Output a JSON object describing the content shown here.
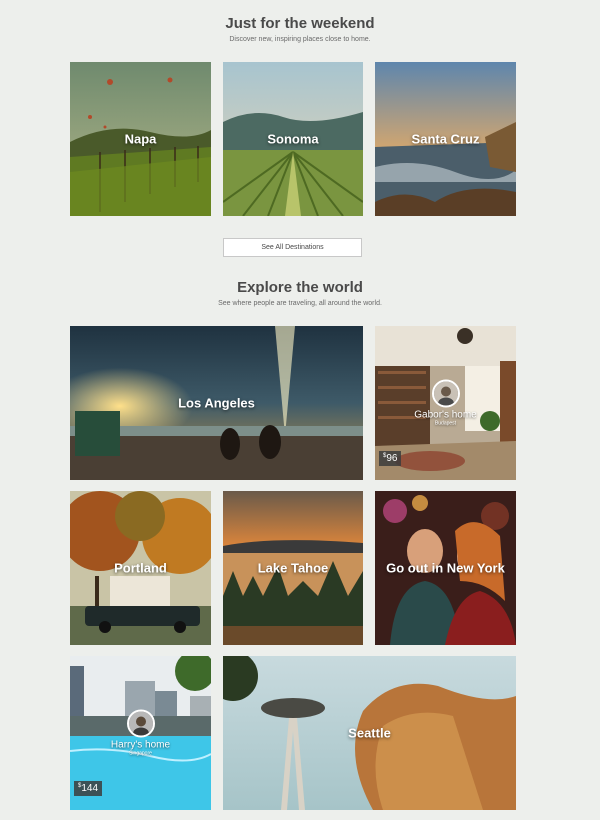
{
  "weekend": {
    "title": "Just for the weekend",
    "subtitle": "Discover new, inspiring places close to home.",
    "destinations": [
      "Napa",
      "Sonoma",
      "Santa Cruz"
    ],
    "button": "See All Destinations"
  },
  "explore": {
    "title": "Explore the world",
    "subtitle": "See where people are traveling, all around the world.",
    "cities": {
      "los_angeles": "Los Angeles",
      "portland": "Portland",
      "lake_tahoe": "Lake Tahoe",
      "new_york": "Go out in New York",
      "seattle": "Seattle"
    },
    "homes": [
      {
        "name": "Gabor's home",
        "city": "Budapest",
        "currency": "$",
        "price": "96"
      },
      {
        "name": "Harry's home",
        "city": "Singapore",
        "currency": "$",
        "price": "144"
      }
    ]
  }
}
